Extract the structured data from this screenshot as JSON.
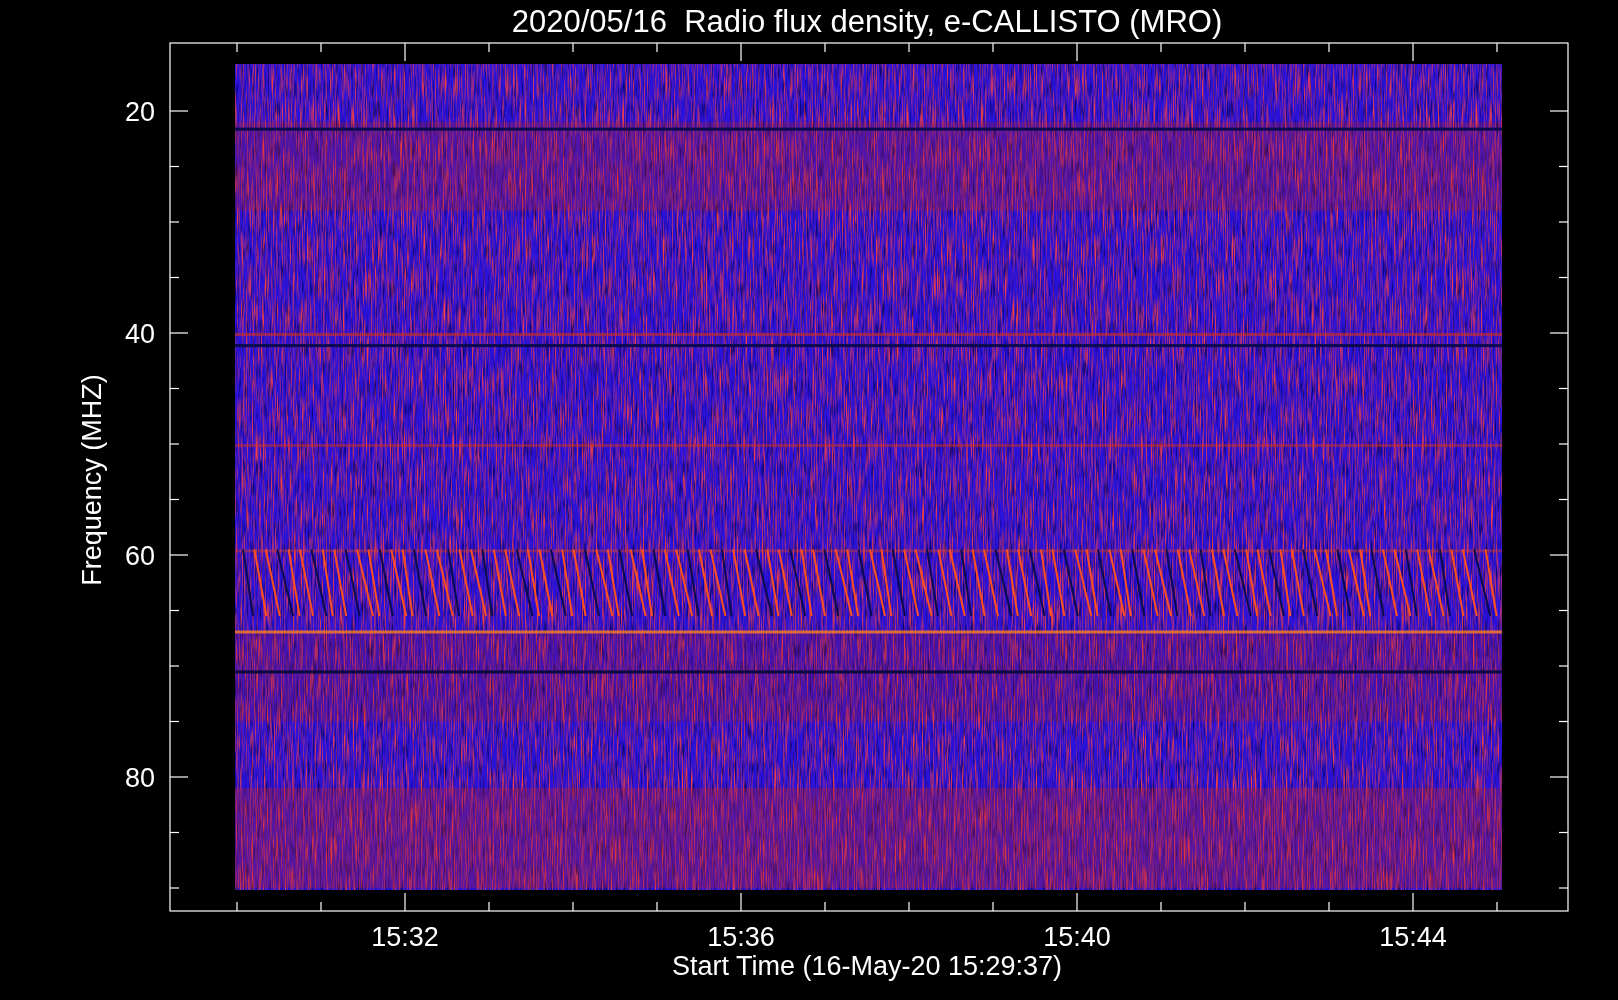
{
  "title": "2020/05/16  Radio flux density, e-CALLISTO (MRO)",
  "plot": {
    "ylabel": "Frequency (MHZ)",
    "xlabel": "Start Time (16-May-20 15:29:37)",
    "y_tick_labels": [
      "20",
      "40",
      "60",
      "80"
    ],
    "x_tick_labels": [
      "15:32",
      "15:36",
      "15:40",
      "15:44"
    ]
  }
}
